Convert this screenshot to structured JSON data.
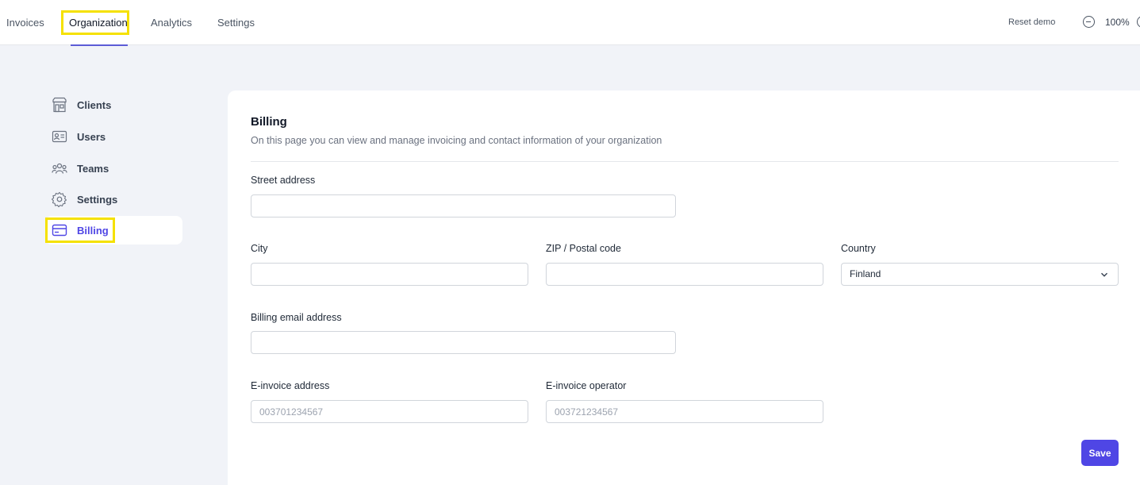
{
  "top_nav": {
    "tabs": [
      {
        "label": "Invoices"
      },
      {
        "label": "Organization",
        "active": true
      },
      {
        "label": "Analytics"
      },
      {
        "label": "Settings"
      }
    ],
    "reset_demo": "Reset demo",
    "zoom": "100%",
    "accent_color": "#5b5bd6",
    "highlight_color": "#f5e100"
  },
  "sidebar": {
    "items": [
      {
        "label": "Clients",
        "icon": "store-icon"
      },
      {
        "label": "Users",
        "icon": "id-card-icon"
      },
      {
        "label": "Teams",
        "icon": "people-icon"
      },
      {
        "label": "Settings",
        "icon": "gear-icon"
      },
      {
        "label": "Billing",
        "icon": "credit-card-icon",
        "active": true
      }
    ]
  },
  "billing": {
    "title": "Billing",
    "description": "On this page you can view and manage invoicing and contact information of your organization",
    "street_address": {
      "label": "Street address",
      "value": "",
      "placeholder": ""
    },
    "city": {
      "label": "City",
      "value": "",
      "placeholder": ""
    },
    "zip": {
      "label": "ZIP / Postal code",
      "value": "",
      "placeholder": ""
    },
    "country": {
      "label": "Country",
      "value": "Finland"
    },
    "billing_email": {
      "label": "Billing email address",
      "value": "",
      "placeholder": ""
    },
    "einvoice_address": {
      "label": "E-invoice address",
      "value": "",
      "placeholder": "003701234567"
    },
    "einvoice_operator": {
      "label": "E-invoice operator",
      "value": "",
      "placeholder": "003721234567"
    },
    "save_label": "Save",
    "primary_color": "#4f46e5"
  }
}
